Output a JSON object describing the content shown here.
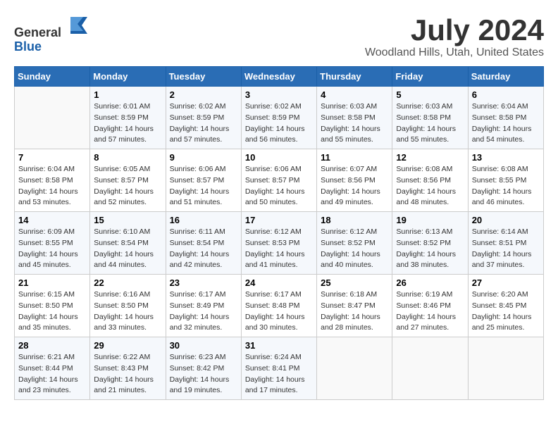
{
  "logo": {
    "general": "General",
    "blue": "Blue"
  },
  "title": "July 2024",
  "location": "Woodland Hills, Utah, United States",
  "days_of_week": [
    "Sunday",
    "Monday",
    "Tuesday",
    "Wednesday",
    "Thursday",
    "Friday",
    "Saturday"
  ],
  "weeks": [
    [
      {
        "day": "",
        "sunrise": "",
        "sunset": "",
        "daylight": ""
      },
      {
        "day": "1",
        "sunrise": "Sunrise: 6:01 AM",
        "sunset": "Sunset: 8:59 PM",
        "daylight": "Daylight: 14 hours and 57 minutes."
      },
      {
        "day": "2",
        "sunrise": "Sunrise: 6:02 AM",
        "sunset": "Sunset: 8:59 PM",
        "daylight": "Daylight: 14 hours and 57 minutes."
      },
      {
        "day": "3",
        "sunrise": "Sunrise: 6:02 AM",
        "sunset": "Sunset: 8:59 PM",
        "daylight": "Daylight: 14 hours and 56 minutes."
      },
      {
        "day": "4",
        "sunrise": "Sunrise: 6:03 AM",
        "sunset": "Sunset: 8:58 PM",
        "daylight": "Daylight: 14 hours and 55 minutes."
      },
      {
        "day": "5",
        "sunrise": "Sunrise: 6:03 AM",
        "sunset": "Sunset: 8:58 PM",
        "daylight": "Daylight: 14 hours and 55 minutes."
      },
      {
        "day": "6",
        "sunrise": "Sunrise: 6:04 AM",
        "sunset": "Sunset: 8:58 PM",
        "daylight": "Daylight: 14 hours and 54 minutes."
      }
    ],
    [
      {
        "day": "7",
        "sunrise": "Sunrise: 6:04 AM",
        "sunset": "Sunset: 8:58 PM",
        "daylight": "Daylight: 14 hours and 53 minutes."
      },
      {
        "day": "8",
        "sunrise": "Sunrise: 6:05 AM",
        "sunset": "Sunset: 8:57 PM",
        "daylight": "Daylight: 14 hours and 52 minutes."
      },
      {
        "day": "9",
        "sunrise": "Sunrise: 6:06 AM",
        "sunset": "Sunset: 8:57 PM",
        "daylight": "Daylight: 14 hours and 51 minutes."
      },
      {
        "day": "10",
        "sunrise": "Sunrise: 6:06 AM",
        "sunset": "Sunset: 8:57 PM",
        "daylight": "Daylight: 14 hours and 50 minutes."
      },
      {
        "day": "11",
        "sunrise": "Sunrise: 6:07 AM",
        "sunset": "Sunset: 8:56 PM",
        "daylight": "Daylight: 14 hours and 49 minutes."
      },
      {
        "day": "12",
        "sunrise": "Sunrise: 6:08 AM",
        "sunset": "Sunset: 8:56 PM",
        "daylight": "Daylight: 14 hours and 48 minutes."
      },
      {
        "day": "13",
        "sunrise": "Sunrise: 6:08 AM",
        "sunset": "Sunset: 8:55 PM",
        "daylight": "Daylight: 14 hours and 46 minutes."
      }
    ],
    [
      {
        "day": "14",
        "sunrise": "Sunrise: 6:09 AM",
        "sunset": "Sunset: 8:55 PM",
        "daylight": "Daylight: 14 hours and 45 minutes."
      },
      {
        "day": "15",
        "sunrise": "Sunrise: 6:10 AM",
        "sunset": "Sunset: 8:54 PM",
        "daylight": "Daylight: 14 hours and 44 minutes."
      },
      {
        "day": "16",
        "sunrise": "Sunrise: 6:11 AM",
        "sunset": "Sunset: 8:54 PM",
        "daylight": "Daylight: 14 hours and 42 minutes."
      },
      {
        "day": "17",
        "sunrise": "Sunrise: 6:12 AM",
        "sunset": "Sunset: 8:53 PM",
        "daylight": "Daylight: 14 hours and 41 minutes."
      },
      {
        "day": "18",
        "sunrise": "Sunrise: 6:12 AM",
        "sunset": "Sunset: 8:52 PM",
        "daylight": "Daylight: 14 hours and 40 minutes."
      },
      {
        "day": "19",
        "sunrise": "Sunrise: 6:13 AM",
        "sunset": "Sunset: 8:52 PM",
        "daylight": "Daylight: 14 hours and 38 minutes."
      },
      {
        "day": "20",
        "sunrise": "Sunrise: 6:14 AM",
        "sunset": "Sunset: 8:51 PM",
        "daylight": "Daylight: 14 hours and 37 minutes."
      }
    ],
    [
      {
        "day": "21",
        "sunrise": "Sunrise: 6:15 AM",
        "sunset": "Sunset: 8:50 PM",
        "daylight": "Daylight: 14 hours and 35 minutes."
      },
      {
        "day": "22",
        "sunrise": "Sunrise: 6:16 AM",
        "sunset": "Sunset: 8:50 PM",
        "daylight": "Daylight: 14 hours and 33 minutes."
      },
      {
        "day": "23",
        "sunrise": "Sunrise: 6:17 AM",
        "sunset": "Sunset: 8:49 PM",
        "daylight": "Daylight: 14 hours and 32 minutes."
      },
      {
        "day": "24",
        "sunrise": "Sunrise: 6:17 AM",
        "sunset": "Sunset: 8:48 PM",
        "daylight": "Daylight: 14 hours and 30 minutes."
      },
      {
        "day": "25",
        "sunrise": "Sunrise: 6:18 AM",
        "sunset": "Sunset: 8:47 PM",
        "daylight": "Daylight: 14 hours and 28 minutes."
      },
      {
        "day": "26",
        "sunrise": "Sunrise: 6:19 AM",
        "sunset": "Sunset: 8:46 PM",
        "daylight": "Daylight: 14 hours and 27 minutes."
      },
      {
        "day": "27",
        "sunrise": "Sunrise: 6:20 AM",
        "sunset": "Sunset: 8:45 PM",
        "daylight": "Daylight: 14 hours and 25 minutes."
      }
    ],
    [
      {
        "day": "28",
        "sunrise": "Sunrise: 6:21 AM",
        "sunset": "Sunset: 8:44 PM",
        "daylight": "Daylight: 14 hours and 23 minutes."
      },
      {
        "day": "29",
        "sunrise": "Sunrise: 6:22 AM",
        "sunset": "Sunset: 8:43 PM",
        "daylight": "Daylight: 14 hours and 21 minutes."
      },
      {
        "day": "30",
        "sunrise": "Sunrise: 6:23 AM",
        "sunset": "Sunset: 8:42 PM",
        "daylight": "Daylight: 14 hours and 19 minutes."
      },
      {
        "day": "31",
        "sunrise": "Sunrise: 6:24 AM",
        "sunset": "Sunset: 8:41 PM",
        "daylight": "Daylight: 14 hours and 17 minutes."
      },
      {
        "day": "",
        "sunrise": "",
        "sunset": "",
        "daylight": ""
      },
      {
        "day": "",
        "sunrise": "",
        "sunset": "",
        "daylight": ""
      },
      {
        "day": "",
        "sunrise": "",
        "sunset": "",
        "daylight": ""
      }
    ]
  ]
}
